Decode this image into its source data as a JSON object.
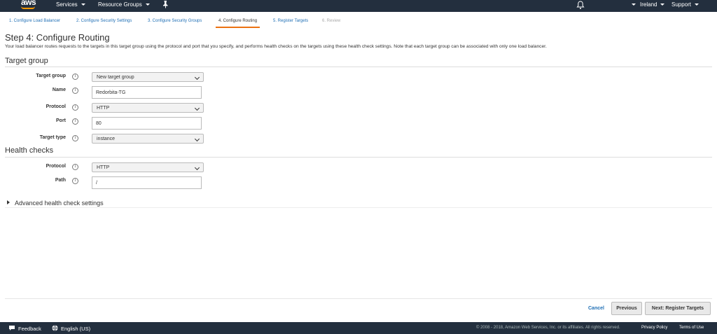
{
  "topnav": {
    "logo": "aws",
    "services": "Services",
    "resource_groups": "Resource Groups",
    "pin_icon": "pin-icon",
    "bell_icon": "bell-icon",
    "region": "Ireland",
    "support": "Support"
  },
  "steps": [
    {
      "label": "1. Configure Load Balancer"
    },
    {
      "label": "2. Configure Security Settings"
    },
    {
      "label": "3. Configure Security Groups"
    },
    {
      "label": "4. Configure Routing"
    },
    {
      "label": "5. Register Targets"
    },
    {
      "label": "6. Review"
    }
  ],
  "page": {
    "title": "Step 4: Configure Routing",
    "description": "Your load balancer routes requests to the targets in this target group using the protocol and port that you specify, and performs health checks on the targets using these health check settings. Note that each target group can be associated with only one load balancer."
  },
  "target_group": {
    "section_title": "Target group",
    "fields": {
      "target_group": {
        "label": "Target group",
        "value": "New target group"
      },
      "name": {
        "label": "Name",
        "value": "Redorbita-TG"
      },
      "protocol": {
        "label": "Protocol",
        "value": "HTTP"
      },
      "port": {
        "label": "Port",
        "value": "80"
      },
      "target_type": {
        "label": "Target type",
        "value": "instance"
      }
    }
  },
  "health_checks": {
    "section_title": "Health checks",
    "fields": {
      "protocol": {
        "label": "Protocol",
        "value": "HTTP"
      },
      "path": {
        "label": "Path",
        "value": "/"
      }
    }
  },
  "advanced": {
    "label": "Advanced health check settings"
  },
  "actions": {
    "cancel": "Cancel",
    "previous": "Previous",
    "next": "Next: Register Targets"
  },
  "footer": {
    "feedback": "Feedback",
    "language": "English (US)",
    "copyright": "© 2008 - 2018, Amazon Web Services, Inc. or its affiliates. All rights reserved.",
    "privacy": "Privacy Policy",
    "terms": "Terms of Use"
  },
  "colors": {
    "nav_bg": "#232f3e",
    "link": "#1f6fb5",
    "active_step": "#ec7211"
  }
}
